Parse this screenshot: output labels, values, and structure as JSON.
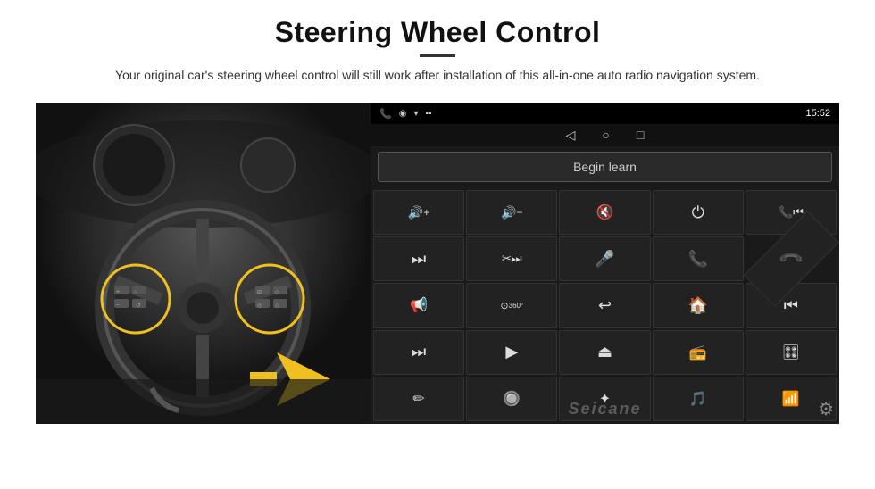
{
  "page": {
    "title": "Steering Wheel Control",
    "divider": "—",
    "subtitle": "Your original car's steering wheel control will still work after installation of this all-in-one auto radio navigation system.",
    "image_alt": "Steering Wheel with controls highlighted"
  },
  "android": {
    "statusbar": {
      "time": "15:52",
      "signal": "▲",
      "wifi": "▾",
      "battery": "▪"
    },
    "nav": {
      "back": "◁",
      "home": "○",
      "recent": "□"
    },
    "begin_learn_label": "Begin learn"
  },
  "controls": [
    {
      "icon": "🔊+",
      "label": "vol-up"
    },
    {
      "icon": "🔊−",
      "label": "vol-down"
    },
    {
      "icon": "🔇",
      "label": "mute"
    },
    {
      "icon": "⏻",
      "label": "power"
    },
    {
      "icon": "📞⏮",
      "label": "call-prev"
    },
    {
      "icon": "⏭",
      "label": "next-track"
    },
    {
      "icon": "✂⏭",
      "label": "seek-fwd"
    },
    {
      "icon": "🎤",
      "label": "mic"
    },
    {
      "icon": "📞",
      "label": "call"
    },
    {
      "icon": "📵",
      "label": "end-call"
    },
    {
      "icon": "📢",
      "label": "speaker"
    },
    {
      "icon": "360°",
      "label": "360-cam"
    },
    {
      "icon": "↩",
      "label": "back"
    },
    {
      "icon": "🏠",
      "label": "home"
    },
    {
      "icon": "⏮⏮",
      "label": "fast-prev"
    },
    {
      "icon": "⏭⏭",
      "label": "fast-fwd"
    },
    {
      "icon": "▶",
      "label": "play-nav"
    },
    {
      "icon": "⏏",
      "label": "eject"
    },
    {
      "icon": "📻",
      "label": "radio"
    },
    {
      "icon": "⚙",
      "label": "settings-eq"
    },
    {
      "icon": "✏",
      "label": "edit"
    },
    {
      "icon": "🔘",
      "label": "knob"
    },
    {
      "icon": "✦",
      "label": "bluetooth"
    },
    {
      "icon": "♪",
      "label": "music"
    },
    {
      "icon": "📶",
      "label": "signal-bars"
    }
  ],
  "watermark": "Seicane",
  "settings_icon": "⚙"
}
